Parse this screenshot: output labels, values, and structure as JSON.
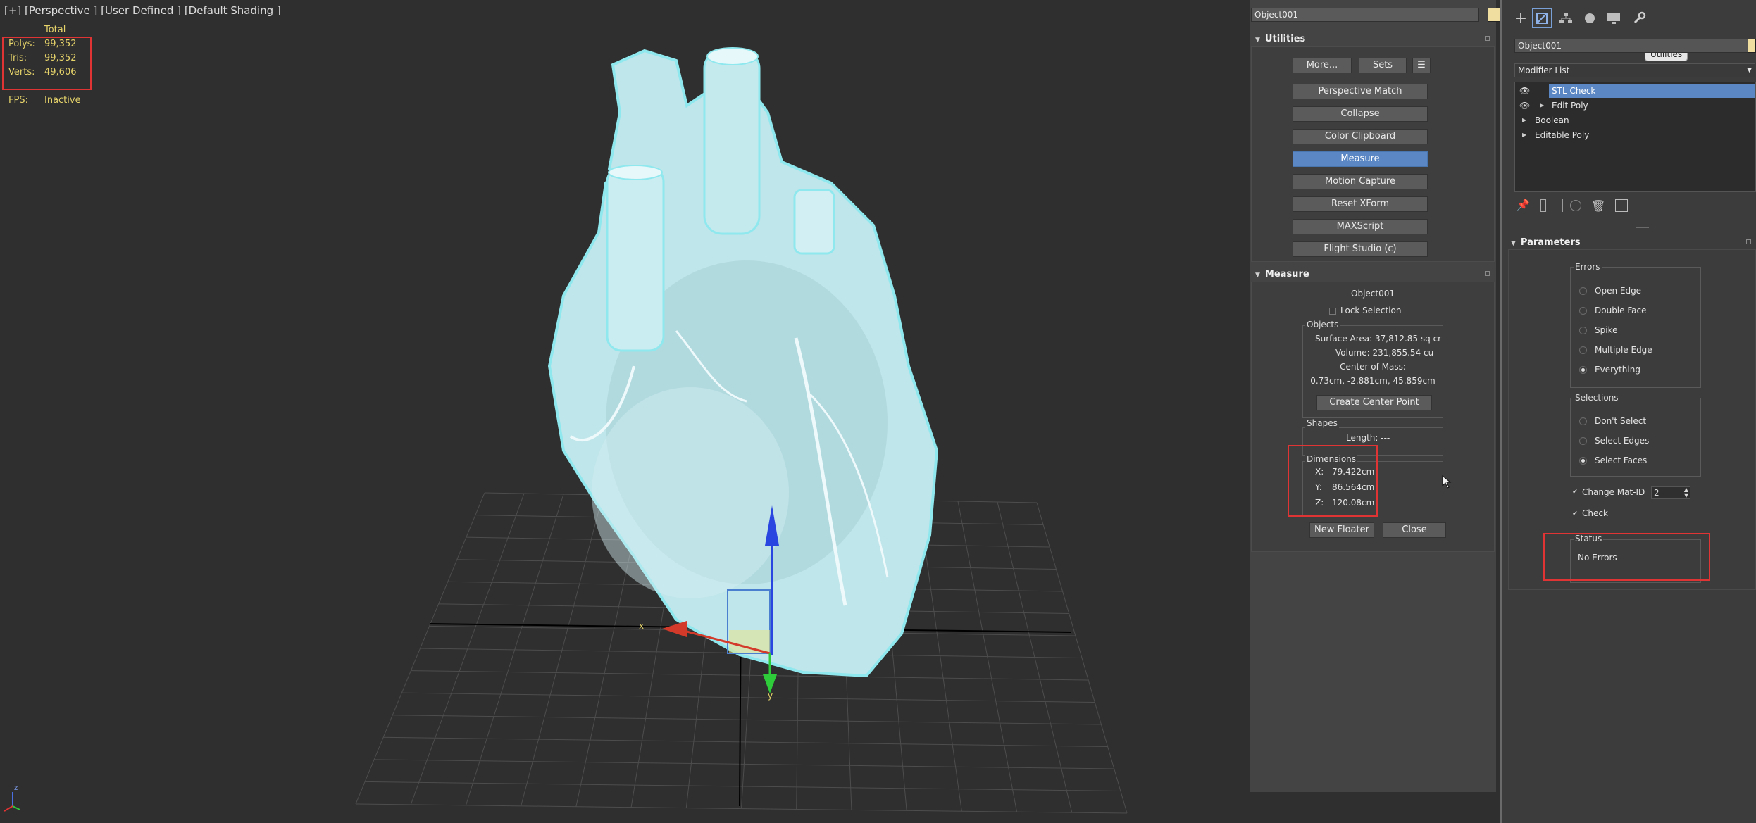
{
  "viewport": {
    "label": "[+] [Perspective ] [User Defined ] [Default Shading ]",
    "stats_header": "Total",
    "stats": [
      {
        "label": "Polys:",
        "value": "99,352"
      },
      {
        "label": "Tris:",
        "value": "99,352"
      },
      {
        "label": "Verts:",
        "value": "49,606"
      }
    ],
    "fps_label": "FPS:",
    "fps_value": "Inactive",
    "gizmo_x": "x",
    "gizmo_y": "y",
    "axis_tripod": "z"
  },
  "utilities": {
    "object_name": "Object001",
    "title": "Utilities",
    "more_button": "More...",
    "sets_button": "Sets",
    "buttons": [
      "Perspective Match",
      "Collapse",
      "Color Clipboard",
      "Measure",
      "Motion Capture",
      "Reset XForm",
      "MAXScript",
      "Flight Studio (c)"
    ],
    "active_button": "Measure"
  },
  "measure": {
    "title": "Measure",
    "object_name": "Object001",
    "lock_selection": "Lock Selection",
    "objects_group": "Objects",
    "surface_area": "Surface Area:  37,812.85 sq cr",
    "volume": "Volume:  231,855.54 cu",
    "center_of_mass_label": "Center of Mass:",
    "center_of_mass_value": "0.73cm, -2.881cm, 45.859cm",
    "create_center_point": "Create Center Point",
    "shapes_group": "Shapes",
    "length": "Length:  ---",
    "dimensions_group": "Dimensions",
    "dims": [
      {
        "axis": "X:",
        "value": "79.422cm"
      },
      {
        "axis": "Y:",
        "value": "86.564cm"
      },
      {
        "axis": "Z:",
        "value": "120.08cm"
      }
    ],
    "new_floater": "New Floater",
    "close": "Close"
  },
  "command_panel": {
    "tooltip": "Utilities",
    "object_name": "Object001",
    "modifier_list": "Modifier List",
    "stack": [
      {
        "name": "STL Check",
        "eye": true,
        "expand": false,
        "selected": true
      },
      {
        "name": "Edit Poly",
        "eye": true,
        "expand": true,
        "selected": false
      },
      {
        "name": "Boolean",
        "eye": false,
        "expand": true,
        "selected": false
      },
      {
        "name": "Editable Poly",
        "eye": false,
        "expand": true,
        "selected": false
      }
    ],
    "parameters_title": "Parameters",
    "errors_group": "Errors",
    "errors": [
      {
        "label": "Open Edge",
        "on": false
      },
      {
        "label": "Double Face",
        "on": false
      },
      {
        "label": "Spike",
        "on": false
      },
      {
        "label": "Multiple Edge",
        "on": false
      },
      {
        "label": "Everything",
        "on": true
      }
    ],
    "selections_group": "Selections",
    "selections": [
      {
        "label": "Don't Select",
        "on": false
      },
      {
        "label": "Select Edges",
        "on": false
      },
      {
        "label": "Select Faces",
        "on": true
      }
    ],
    "change_mat_id": "Change Mat-ID",
    "mat_id_value": "2",
    "check": "Check",
    "status_group": "Status",
    "status_text": "No Errors"
  },
  "colors": {
    "accent": "#5b88c4",
    "highlight_box": "#e03434",
    "stats_text": "#e6d36a",
    "wireframe": "#8fe8ee"
  }
}
